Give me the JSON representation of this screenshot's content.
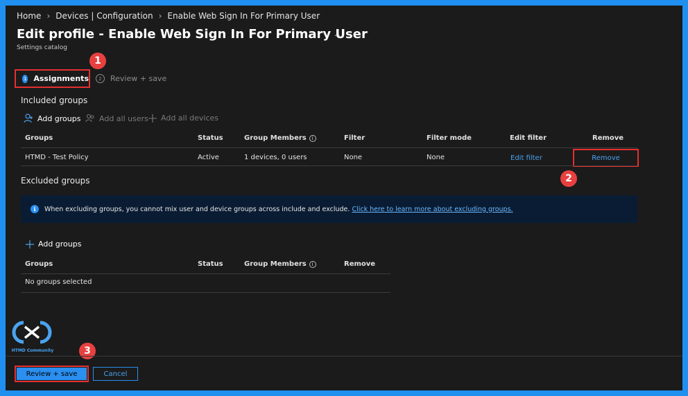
{
  "breadcrumb": [
    "Home",
    "Devices | Configuration",
    "Enable Web Sign In For Primary User"
  ],
  "page": {
    "title": "Edit profile - Enable Web Sign In For Primary User",
    "more": "...",
    "subtitle": "Settings catalog"
  },
  "steps": [
    {
      "number": "1",
      "label": "Assignments",
      "state": "active"
    },
    {
      "number": "2",
      "label": "Review + save",
      "state": "inactive"
    }
  ],
  "included": {
    "title": "Included groups",
    "commands": {
      "add_groups": "Add groups",
      "add_all_users": "Add all users",
      "add_all_devices": "Add all devices"
    },
    "columns": [
      "Groups",
      "Status",
      "Group Members",
      "Filter",
      "Filter mode",
      "Edit filter",
      "Remove"
    ],
    "rows": [
      {
        "group": "HTMD - Test Policy",
        "status": "Active",
        "members": "1 devices, 0 users",
        "filter": "None",
        "filter_mode": "None",
        "edit_filter": "Edit filter",
        "remove": "Remove"
      }
    ]
  },
  "excluded": {
    "title": "Excluded groups",
    "info_text": "When excluding groups, you cannot mix user and device groups across include and exclude.",
    "info_link": "Click here to learn more about excluding groups.",
    "add_groups": "Add groups",
    "columns": [
      "Groups",
      "Status",
      "Group Members",
      "Remove"
    ],
    "empty": "No groups selected"
  },
  "footer": {
    "primary": "Review + save",
    "secondary": "Cancel"
  },
  "logo_text": "HTMD Community",
  "markers": [
    "1",
    "2",
    "3"
  ],
  "colors": {
    "accent": "#2a8ff0",
    "highlight": "#e63030",
    "marker": "#e84040",
    "border": "#1f8ff0"
  }
}
